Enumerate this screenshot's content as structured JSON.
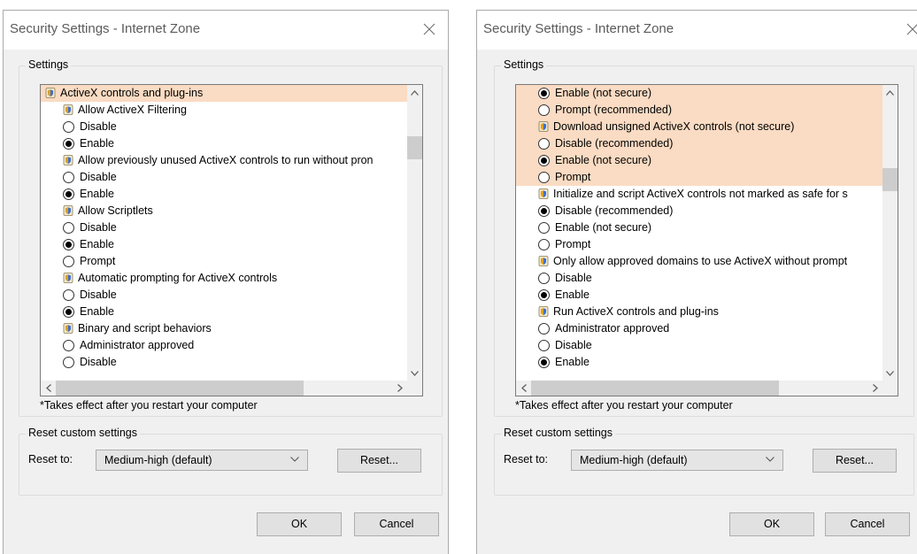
{
  "dialogs": [
    {
      "title": "Security Settings - Internet Zone",
      "settings_label": "Settings",
      "list": [
        {
          "kind": "cat",
          "text": "ActiveX controls and plug-ins",
          "highlight": true
        },
        {
          "kind": "cat",
          "indent": 1,
          "text": "Allow ActiveX Filtering"
        },
        {
          "kind": "opt",
          "text": "Disable",
          "checked": false
        },
        {
          "kind": "opt",
          "text": "Enable",
          "checked": true
        },
        {
          "kind": "cat",
          "indent": 1,
          "text": "Allow previously unused ActiveX controls to run without pron"
        },
        {
          "kind": "opt",
          "text": "Disable",
          "checked": false
        },
        {
          "kind": "opt",
          "text": "Enable",
          "checked": true
        },
        {
          "kind": "cat",
          "indent": 1,
          "text": "Allow Scriptlets"
        },
        {
          "kind": "opt",
          "text": "Disable",
          "checked": false
        },
        {
          "kind": "opt",
          "text": "Enable",
          "checked": true
        },
        {
          "kind": "opt",
          "text": "Prompt",
          "checked": false
        },
        {
          "kind": "cat",
          "indent": 1,
          "text": "Automatic prompting for ActiveX controls"
        },
        {
          "kind": "opt",
          "text": "Disable",
          "checked": false
        },
        {
          "kind": "opt",
          "text": "Enable",
          "checked": true
        },
        {
          "kind": "cat",
          "indent": 1,
          "text": "Binary and script behaviors"
        },
        {
          "kind": "opt",
          "text": "Administrator approved",
          "checked": false
        },
        {
          "kind": "opt",
          "text": "Disable",
          "checked": false
        }
      ],
      "note": "*Takes effect after you restart your computer",
      "reset_group_label": "Reset custom settings",
      "reset_to_label": "Reset to:",
      "reset_select_value": "Medium-high (default)",
      "reset_button": "Reset...",
      "ok_button": "OK",
      "cancel_button": "Cancel"
    },
    {
      "title": "Security Settings - Internet Zone",
      "settings_label": "Settings",
      "list": [
        {
          "kind": "opt",
          "text": "Enable (not secure)",
          "checked": true,
          "highlight": true
        },
        {
          "kind": "opt",
          "text": "Prompt (recommended)",
          "checked": false,
          "highlight": true
        },
        {
          "kind": "cat",
          "indent": 1,
          "text": "Download unsigned ActiveX controls (not secure)",
          "highlight": true
        },
        {
          "kind": "opt",
          "text": "Disable (recommended)",
          "checked": false,
          "highlight": true
        },
        {
          "kind": "opt",
          "text": "Enable (not secure)",
          "checked": true,
          "highlight": true
        },
        {
          "kind": "opt",
          "text": "Prompt",
          "checked": false,
          "highlight": true
        },
        {
          "kind": "cat",
          "indent": 1,
          "text": "Initialize and script ActiveX controls not marked as safe for s"
        },
        {
          "kind": "opt",
          "text": "Disable (recommended)",
          "checked": true
        },
        {
          "kind": "opt",
          "text": "Enable (not secure)",
          "checked": false
        },
        {
          "kind": "opt",
          "text": "Prompt",
          "checked": false
        },
        {
          "kind": "cat",
          "indent": 1,
          "text": "Only allow approved domains to use ActiveX without prompt"
        },
        {
          "kind": "opt",
          "text": "Disable",
          "checked": false
        },
        {
          "kind": "opt",
          "text": "Enable",
          "checked": true
        },
        {
          "kind": "cat",
          "indent": 1,
          "text": "Run ActiveX controls and plug-ins"
        },
        {
          "kind": "opt",
          "text": "Administrator approved",
          "checked": false
        },
        {
          "kind": "opt",
          "text": "Disable",
          "checked": false
        },
        {
          "kind": "opt",
          "text": "Enable",
          "checked": true
        }
      ],
      "note": "*Takes effect after you restart your computer",
      "reset_group_label": "Reset custom settings",
      "reset_to_label": "Reset to:",
      "reset_select_value": "Medium-high (default)",
      "reset_button": "Reset...",
      "ok_button": "OK",
      "cancel_button": "Cancel"
    }
  ],
  "colors": {
    "highlight": "#fadbc3",
    "dialog_bg": "#f0f0f0"
  },
  "icons": {
    "close": "close-icon",
    "setting": "settings-shield-icon",
    "scroll_up": "chevron-up-icon",
    "scroll_down": "chevron-down-icon",
    "scroll_left": "chevron-left-icon",
    "scroll_right": "chevron-right-icon",
    "dropdown": "chevron-down-icon"
  }
}
